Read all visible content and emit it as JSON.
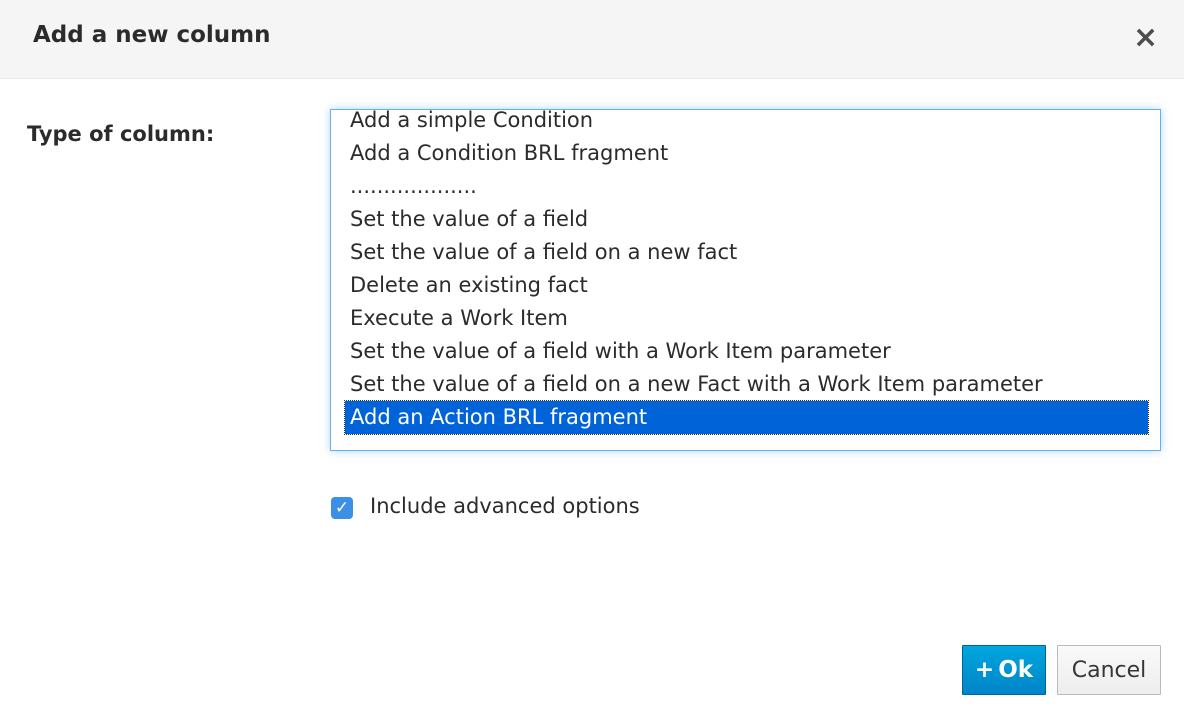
{
  "dialog": {
    "title": "Add a new column",
    "close_label": "×"
  },
  "form": {
    "type_label": "Type of column:",
    "options": [
      "...................",
      "Add a simple Condition",
      "Add a Condition BRL fragment",
      "...................",
      "Set the value of a field",
      "Set the value of a field on a new fact",
      "Delete an existing fact",
      "Execute a Work Item",
      "Set the value of a field with a Work Item parameter",
      "Set the value of a field on a new Fact with a Work Item parameter",
      "Add an Action BRL fragment"
    ],
    "selected": "Add an Action BRL fragment",
    "advanced": {
      "label": "Include advanced options",
      "checked": true,
      "check_glyph": "✓"
    }
  },
  "footer": {
    "ok_icon": "+",
    "ok_label": "Ok",
    "cancel_label": "Cancel"
  },
  "colors": {
    "accent": "#0088ce",
    "selection": "#0063d8"
  }
}
